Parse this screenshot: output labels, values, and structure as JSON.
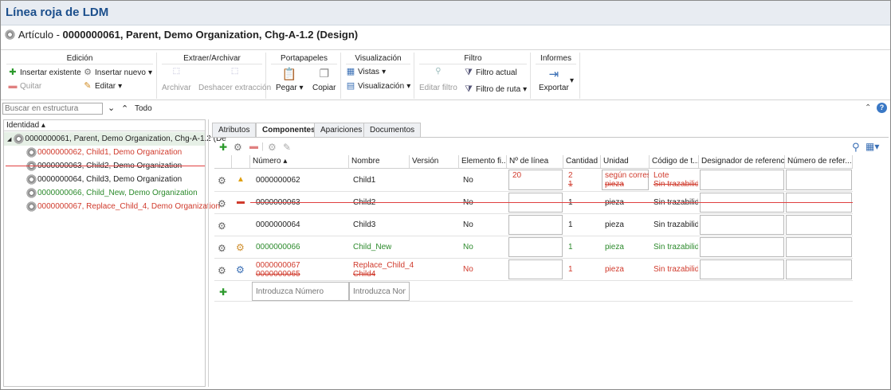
{
  "window_title": "Línea roja de LDM",
  "subtitle": {
    "prefix": "Artículo - ",
    "item": "0000000061, Parent, Demo Organization, Chg-A-1.2 (Design)"
  },
  "ribbon": {
    "edicion": {
      "title": "Edición",
      "insert_existing": "Insertar existente",
      "insert_new": "Insertar nuevo",
      "remove": "Quitar",
      "edit": "Editar"
    },
    "extraer": {
      "title": "Extraer/Archivar",
      "archive": "Archivar",
      "undo_checkout": "Deshacer extracción"
    },
    "portapapeles": {
      "title": "Portapapeles",
      "paste": "Pegar",
      "copy": "Copiar"
    },
    "visualizacion": {
      "title": "Visualización",
      "views": "Vistas",
      "visualization": "Visualización"
    },
    "filtro": {
      "title": "Filtro",
      "edit_filter": "Editar filtro",
      "current_filter": "Filtro actual",
      "path_filter": "Filtro de ruta"
    },
    "informes": {
      "title": "Informes",
      "export": "Exportar"
    }
  },
  "search": {
    "placeholder": "Buscar en estructura",
    "all": "Todo"
  },
  "tree": {
    "header": "Identidad",
    "root": "0000000061, Parent, Demo Organization, Chg-A-1.2 (De",
    "children": [
      {
        "label": "0000000062, Child1, Demo Organization",
        "status": "changed"
      },
      {
        "label": "0000000063, Child2, Demo Organization",
        "status": "removed"
      },
      {
        "label": "0000000064, Child3, Demo Organization",
        "status": "unchanged"
      },
      {
        "label": "0000000066, Child_New, Demo Organization",
        "status": "added"
      },
      {
        "label": "0000000067, Replace_Child_4, Demo Organization",
        "status": "replaced"
      }
    ]
  },
  "tabs": [
    "Atributos",
    "Componentes",
    "Apariciones",
    "Documentos"
  ],
  "active_tab": "Componentes",
  "columns": [
    "Número",
    "Nombre",
    "Versión",
    "Elemento fi...",
    "Nº de línea",
    "Cantidad",
    "Unidad",
    "Código de t...",
    "Designador de referenc...",
    "Número de refer..."
  ],
  "rows": [
    {
      "status": "changed",
      "number": "0000000062",
      "name": "Child1",
      "elem": "No",
      "line": "20",
      "qty_new": "2",
      "qty_old": "1",
      "unit_new": "según corresp",
      "unit_old": "pieza",
      "code_new": "Lote",
      "code_old": "Sin trazabilida"
    },
    {
      "status": "removed",
      "number": "0000000063",
      "name": "Child2",
      "elem": "No",
      "qty": "1",
      "unit": "pieza",
      "code": "Sin trazabilida"
    },
    {
      "status": "unchanged",
      "number": "0000000064",
      "name": "Child3",
      "elem": "No",
      "qty": "1",
      "unit": "pieza",
      "code": "Sin trazabilida"
    },
    {
      "status": "added",
      "number": "0000000066",
      "name": "Child_New",
      "elem": "No",
      "qty": "1",
      "unit": "pieza",
      "code": "Sin trazabilida"
    },
    {
      "status": "replaced",
      "number_new": "0000000067",
      "number_old": "0000000065",
      "name_new": "Replace_Child_4",
      "name_old": "Child4",
      "elem": "No",
      "qty": "1",
      "unit": "pieza",
      "code": "Sin trazabilida"
    }
  ],
  "new_row": {
    "number_placeholder": "Introduzca Número",
    "name_placeholder": "Introduzca Nombr"
  },
  "colors": {
    "added": "#2c8a2c",
    "changed": "#d03a2c",
    "title": "#1c4f8c"
  }
}
